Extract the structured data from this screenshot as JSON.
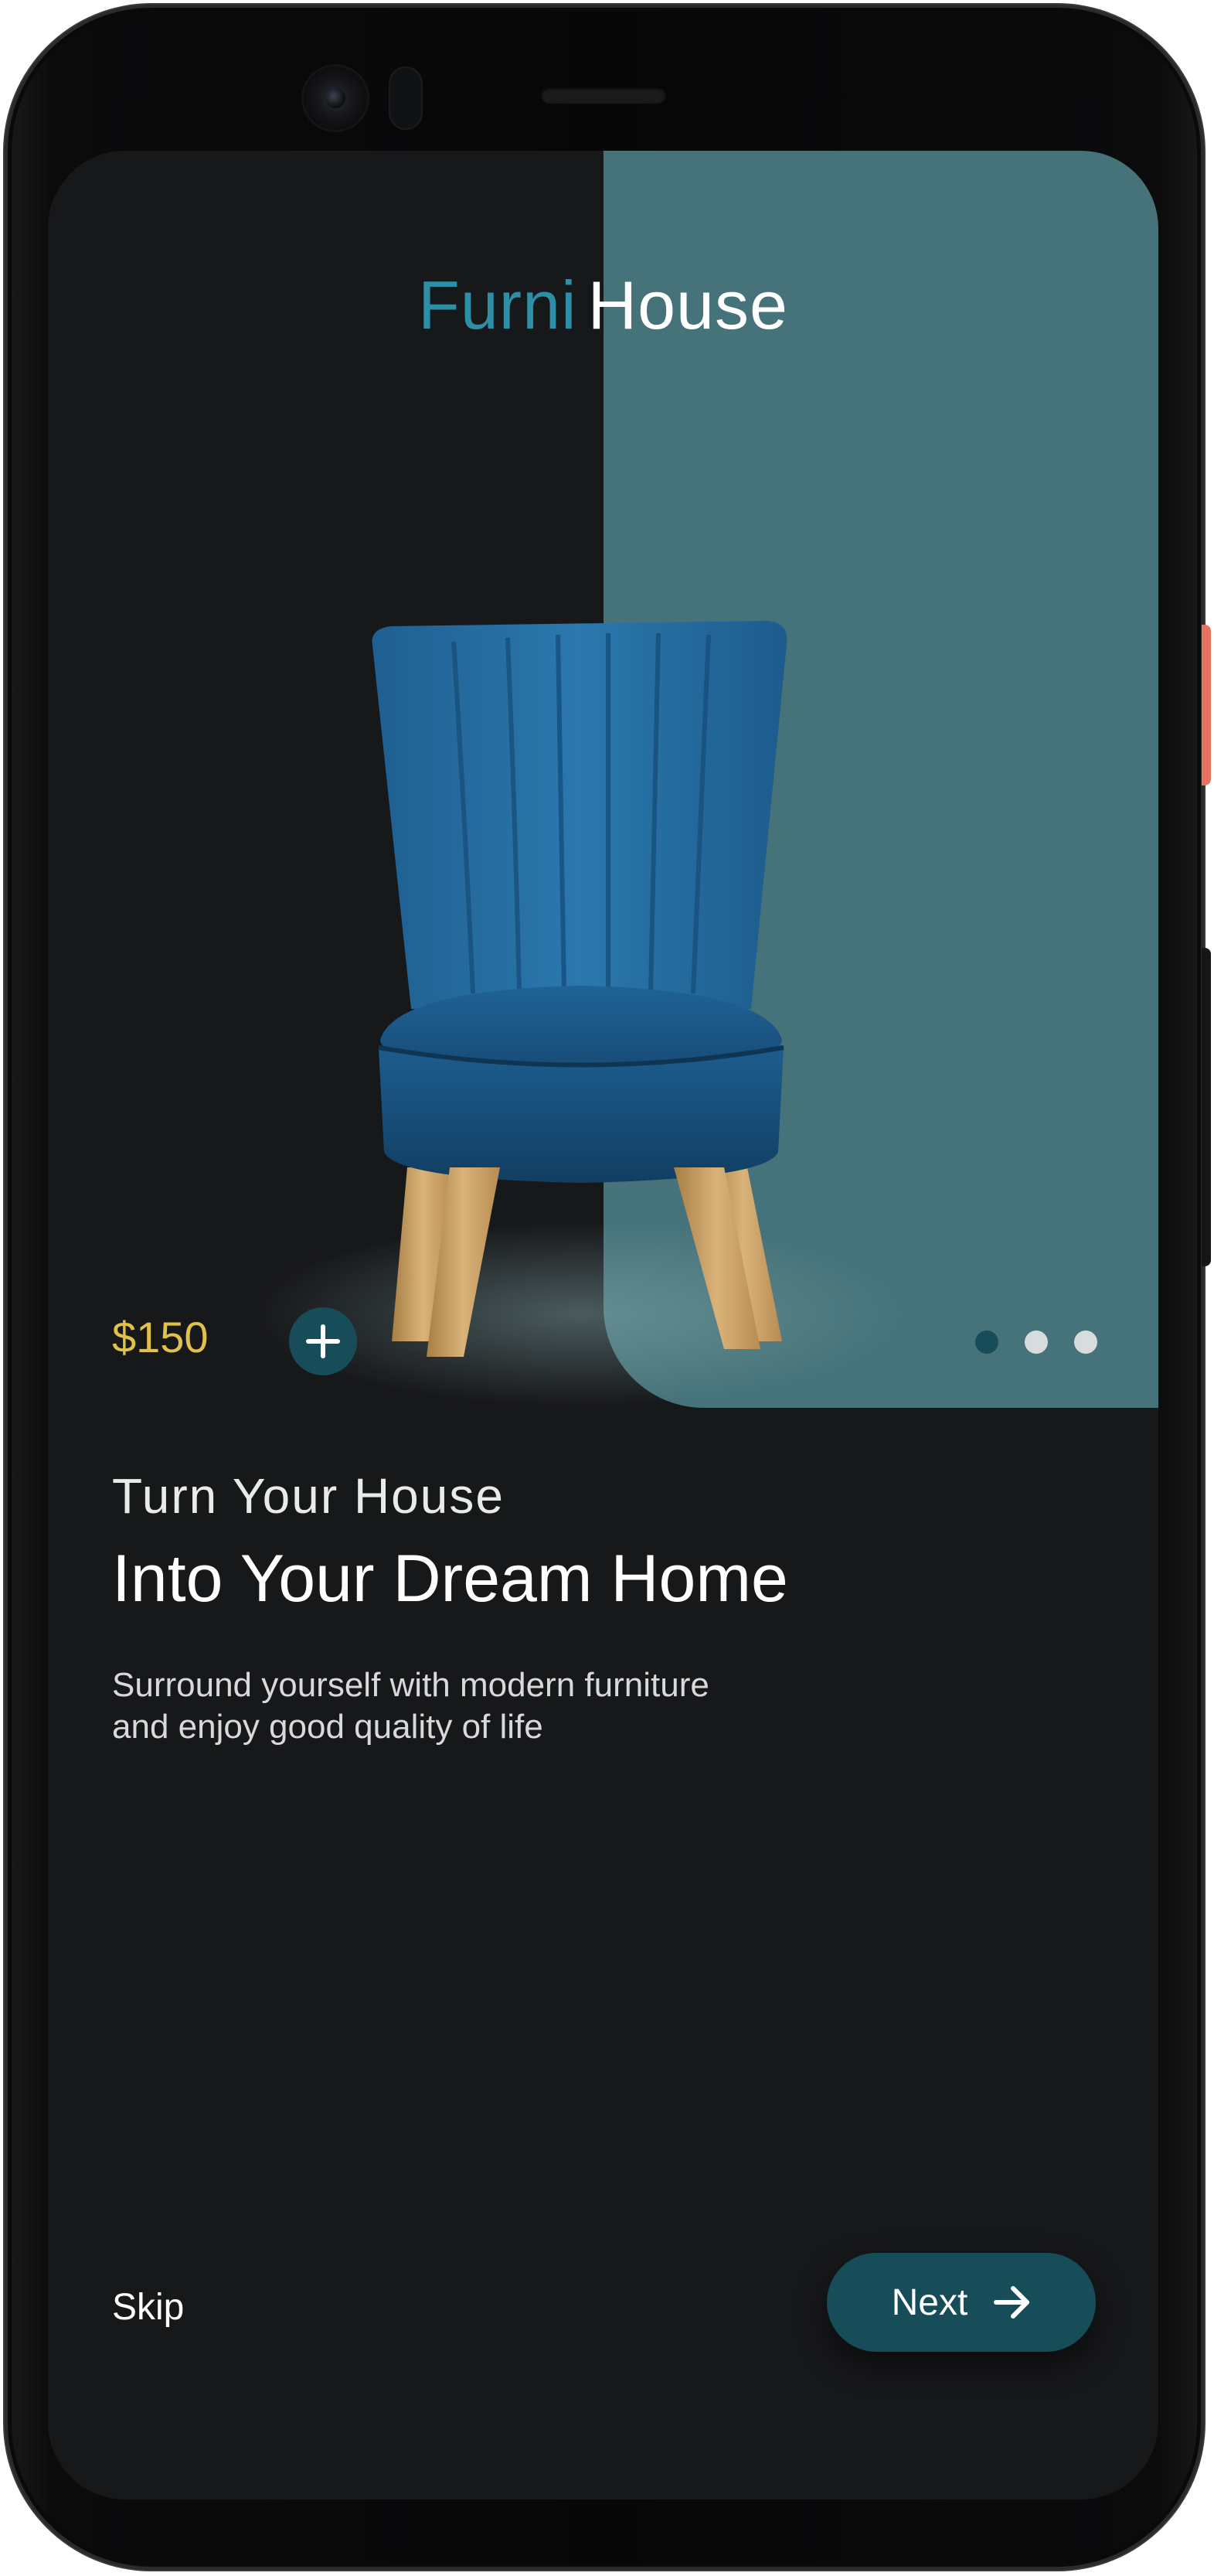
{
  "brand": {
    "part1": "Furni",
    "part2": "House"
  },
  "product": {
    "price": "$150",
    "image_icon": "armchair-icon",
    "add_icon": "plus-icon"
  },
  "pager": {
    "count": 3,
    "active_index": 0
  },
  "copy": {
    "subtitle": "Turn Your House",
    "headline": "Into Your Dream Home",
    "description_line1": "Surround yourself with modern furniture",
    "description_line2": "and enjoy good quality of life"
  },
  "actions": {
    "skip_label": "Skip",
    "next_label": "Next",
    "next_icon": "arrow-right-icon"
  },
  "colors": {
    "background": "#17181a",
    "panel": "#46737a",
    "accent": "#164d59",
    "brand_blue": "#2e8ea6",
    "price": "#e2c14a"
  }
}
